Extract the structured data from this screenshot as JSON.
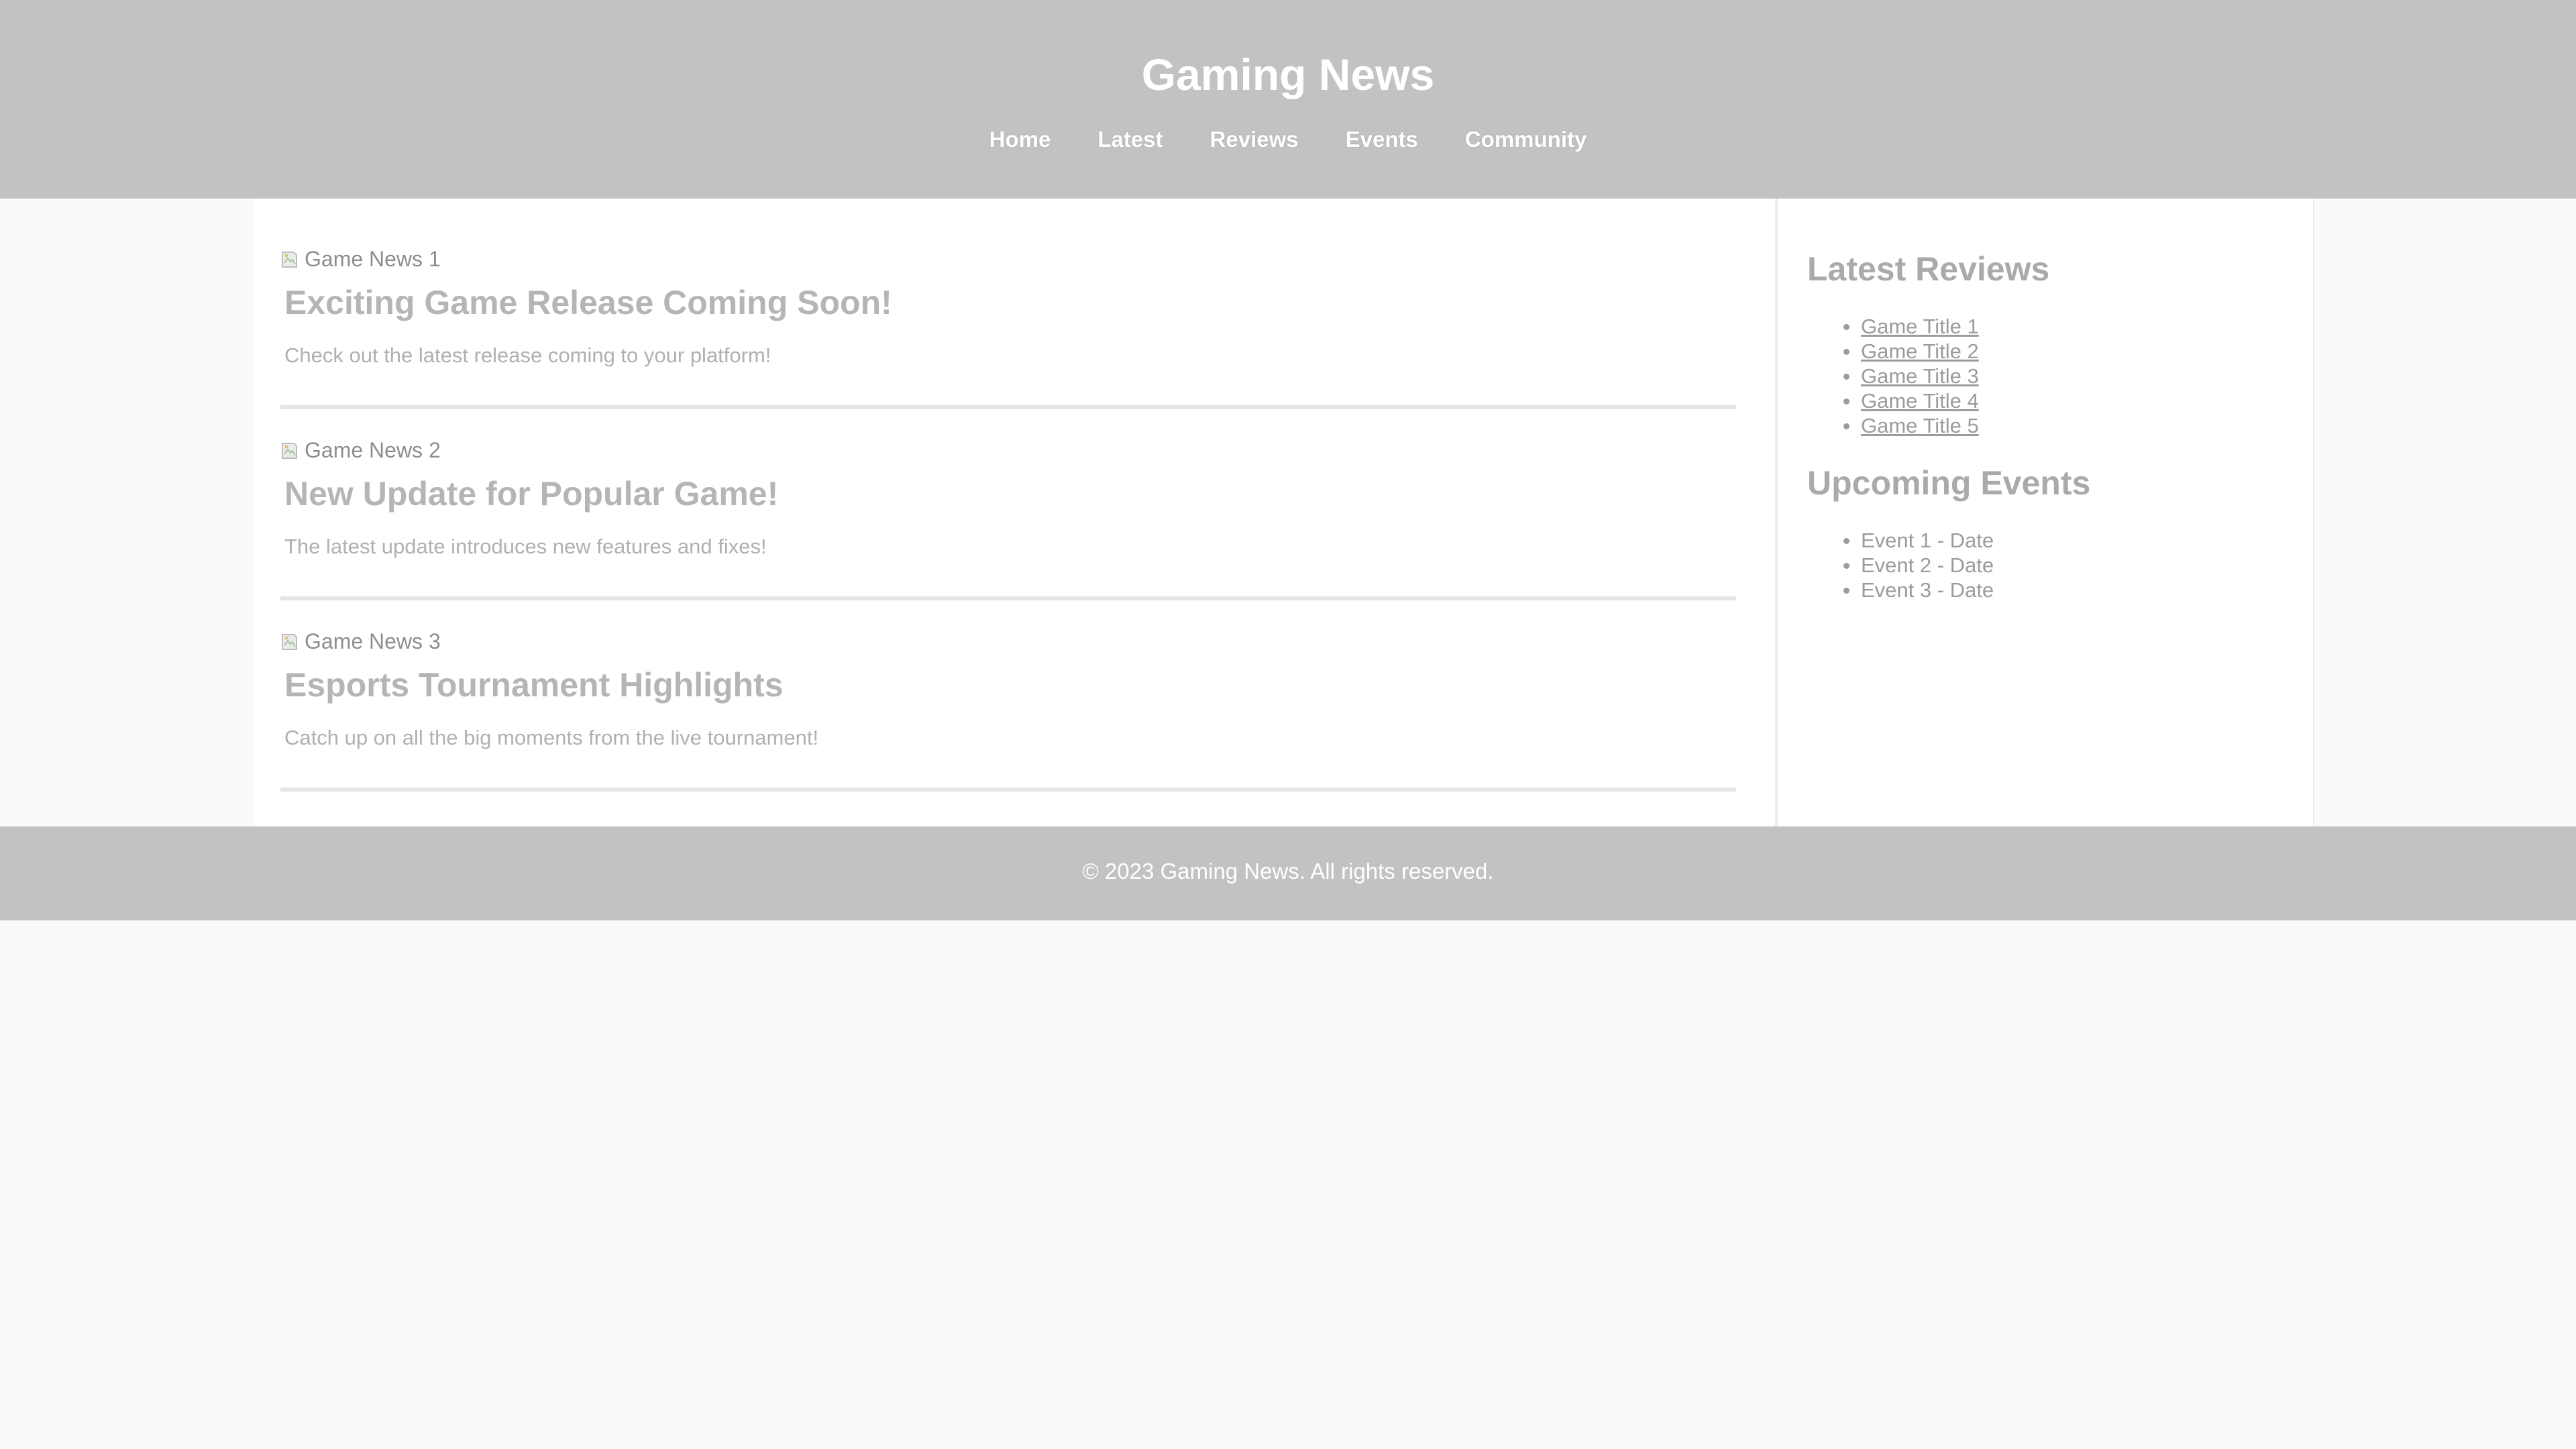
{
  "header": {
    "title": "Gaming News",
    "nav": [
      "Home",
      "Latest",
      "Reviews",
      "Events",
      "Community"
    ]
  },
  "articles": [
    {
      "image_alt": "Game News 1",
      "title": "Exciting Game Release Coming Soon!",
      "summary": "Check out the latest release coming to your platform!"
    },
    {
      "image_alt": "Game News 2",
      "title": "New Update for Popular Game!",
      "summary": "The latest update introduces new features and fixes!"
    },
    {
      "image_alt": "Game News 3",
      "title": "Esports Tournament Highlights",
      "summary": "Catch up on all the big moments from the live tournament!"
    }
  ],
  "sidebar": {
    "reviews_heading": "Latest Reviews",
    "reviews": [
      "Game Title 1",
      "Game Title 2",
      "Game Title 3",
      "Game Title 4",
      "Game Title 5"
    ],
    "events_heading": "Upcoming Events",
    "events": [
      "Event 1 - Date",
      "Event 2 - Date",
      "Event 3 - Date"
    ]
  },
  "footer": {
    "text": "© 2023 Gaming News. All rights reserved."
  },
  "icons": {
    "broken_image": "broken-image-icon"
  },
  "colors": {
    "header_bg": "#c2c2c2",
    "page_bg": "#fafafa"
  }
}
